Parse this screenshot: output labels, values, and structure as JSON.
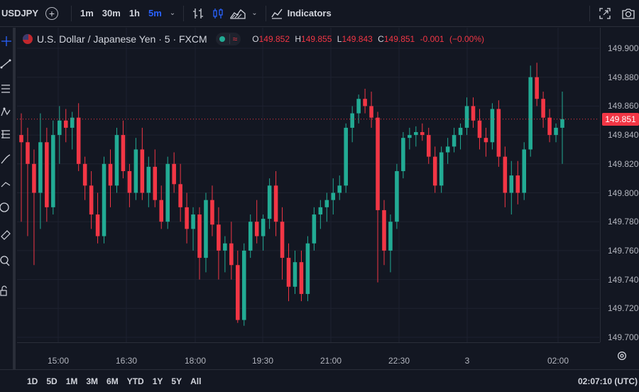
{
  "toolbar": {
    "symbol": "USDJPY",
    "intervals": [
      "1m",
      "30m",
      "1h",
      "5m"
    ],
    "active_interval": "5m",
    "indicators_label": "Indicators",
    "icons": [
      "compare-add-icon",
      "interval-chevron-icon",
      "bar-style-icon",
      "candle-style-icon",
      "area-style-icon",
      "chart-type-chevron-icon",
      "indicators-icon",
      "fullscreen-icon",
      "snapshot-camera-icon"
    ]
  },
  "legend": {
    "title": "U.S. Dollar / Japanese Yen · 5 · FXCM",
    "market_status_icons": [
      "market-open-dot-icon",
      "approx-icon"
    ],
    "approx_symbol": "≈",
    "o_label": "O",
    "o_value": "149.852",
    "h_label": "H",
    "h_value": "149.855",
    "l_label": "L",
    "l_value": "149.843",
    "c_label": "C",
    "c_value": "149.851",
    "change": "-0.001",
    "change_pct": "(−0.00%)"
  },
  "colors": {
    "background": "#131722",
    "up": "#22ab94",
    "down": "#f23645",
    "grid": "#1e2230",
    "text": "#d1d4dc",
    "active": "#2962ff"
  },
  "price_scale": {
    "ticks": [
      "149.900",
      "149.880",
      "149.860",
      "149.840",
      "149.820",
      "149.800",
      "149.780",
      "149.760",
      "149.740",
      "149.720",
      "149.700"
    ],
    "last_price": "149.851"
  },
  "time_scale": {
    "ticks": [
      "15:00",
      "16:30",
      "18:00",
      "19:30",
      "21:00",
      "22:30",
      "3",
      "02:00"
    ],
    "settings_icon": "gear-icon"
  },
  "left_tools_icons": [
    "crosshair-icon",
    "trend-line-icon",
    "fib-icon",
    "brush-icon",
    "text-icon",
    "pattern-icon",
    "circle-icon",
    "ruler-icon",
    "zoom-icon",
    "lock-icon"
  ],
  "bottom_bar": {
    "ranges": [
      "1D",
      "5D",
      "1M",
      "3M",
      "6M",
      "YTD",
      "1Y",
      "5Y",
      "All"
    ],
    "clock": "02:07:10 (UTC)"
  },
  "chart_data": {
    "type": "candlestick",
    "symbol": "USDJPY",
    "ylim": [
      149.69,
      149.915
    ],
    "grid": true,
    "last_price": 149.851,
    "x": [
      "15:00",
      "16:30",
      "18:00",
      "19:30",
      "21:00",
      "22:30",
      "3",
      "02:00"
    ],
    "candles": [
      {
        "o": 149.84,
        "h": 149.855,
        "l": 149.78,
        "c": 149.835
      },
      {
        "o": 149.835,
        "h": 149.845,
        "l": 149.77,
        "c": 149.82
      },
      {
        "o": 149.82,
        "h": 149.83,
        "l": 149.75,
        "c": 149.8
      },
      {
        "o": 149.8,
        "h": 149.855,
        "l": 149.775,
        "c": 149.835
      },
      {
        "o": 149.835,
        "h": 149.845,
        "l": 149.78,
        "c": 149.79
      },
      {
        "o": 149.79,
        "h": 149.85,
        "l": 149.785,
        "c": 149.84
      },
      {
        "o": 149.84,
        "h": 149.86,
        "l": 149.82,
        "c": 149.85
      },
      {
        "o": 149.85,
        "h": 149.858,
        "l": 149.835,
        "c": 149.845
      },
      {
        "o": 149.845,
        "h": 149.856,
        "l": 149.83,
        "c": 149.852
      },
      {
        "o": 149.852,
        "h": 149.862,
        "l": 149.815,
        "c": 149.82
      },
      {
        "o": 149.82,
        "h": 149.825,
        "l": 149.795,
        "c": 149.805
      },
      {
        "o": 149.805,
        "h": 149.815,
        "l": 149.775,
        "c": 149.785
      },
      {
        "o": 149.785,
        "h": 149.8,
        "l": 149.765,
        "c": 149.77
      },
      {
        "o": 149.77,
        "h": 149.825,
        "l": 149.765,
        "c": 149.82
      },
      {
        "o": 149.82,
        "h": 149.83,
        "l": 149.79,
        "c": 149.805
      },
      {
        "o": 149.805,
        "h": 149.845,
        "l": 149.8,
        "c": 149.84
      },
      {
        "o": 149.84,
        "h": 149.85,
        "l": 149.81,
        "c": 149.815
      },
      {
        "o": 149.815,
        "h": 149.82,
        "l": 149.79,
        "c": 149.8
      },
      {
        "o": 149.8,
        "h": 149.838,
        "l": 149.795,
        "c": 149.83
      },
      {
        "o": 149.83,
        "h": 149.845,
        "l": 149.795,
        "c": 149.8
      },
      {
        "o": 149.8,
        "h": 149.825,
        "l": 149.79,
        "c": 149.818
      },
      {
        "o": 149.818,
        "h": 149.83,
        "l": 149.79,
        "c": 149.795
      },
      {
        "o": 149.795,
        "h": 149.805,
        "l": 149.775,
        "c": 149.78
      },
      {
        "o": 149.78,
        "h": 149.825,
        "l": 149.775,
        "c": 149.82
      },
      {
        "o": 149.82,
        "h": 149.828,
        "l": 149.8,
        "c": 149.806
      },
      {
        "o": 149.806,
        "h": 149.82,
        "l": 149.78,
        "c": 149.79
      },
      {
        "o": 149.79,
        "h": 149.8,
        "l": 149.765,
        "c": 149.775
      },
      {
        "o": 149.775,
        "h": 149.79,
        "l": 149.76,
        "c": 149.785
      },
      {
        "o": 149.785,
        "h": 149.79,
        "l": 149.74,
        "c": 149.755
      },
      {
        "o": 149.755,
        "h": 149.8,
        "l": 149.745,
        "c": 149.795
      },
      {
        "o": 149.795,
        "h": 149.805,
        "l": 149.77,
        "c": 149.778
      },
      {
        "o": 149.778,
        "h": 149.79,
        "l": 149.74,
        "c": 149.76
      },
      {
        "o": 149.76,
        "h": 149.77,
        "l": 149.745,
        "c": 149.765
      },
      {
        "o": 149.765,
        "h": 149.78,
        "l": 149.74,
        "c": 149.75
      },
      {
        "o": 149.75,
        "h": 149.76,
        "l": 149.71,
        "c": 149.712
      },
      {
        "o": 149.712,
        "h": 149.765,
        "l": 149.708,
        "c": 149.76
      },
      {
        "o": 149.76,
        "h": 149.785,
        "l": 149.755,
        "c": 149.78
      },
      {
        "o": 149.78,
        "h": 149.795,
        "l": 149.765,
        "c": 149.77
      },
      {
        "o": 149.77,
        "h": 149.785,
        "l": 149.76,
        "c": 149.782
      },
      {
        "o": 149.782,
        "h": 149.81,
        "l": 149.775,
        "c": 149.805
      },
      {
        "o": 149.805,
        "h": 149.815,
        "l": 149.77,
        "c": 149.78
      },
      {
        "o": 149.78,
        "h": 149.79,
        "l": 149.74,
        "c": 149.755
      },
      {
        "o": 149.755,
        "h": 149.765,
        "l": 149.725,
        "c": 149.735
      },
      {
        "o": 149.735,
        "h": 149.76,
        "l": 149.73,
        "c": 149.752
      },
      {
        "o": 149.752,
        "h": 149.76,
        "l": 149.725,
        "c": 149.73
      },
      {
        "o": 149.73,
        "h": 149.77,
        "l": 149.725,
        "c": 149.765
      },
      {
        "o": 149.765,
        "h": 149.79,
        "l": 149.76,
        "c": 149.785
      },
      {
        "o": 149.785,
        "h": 149.795,
        "l": 149.775,
        "c": 149.79
      },
      {
        "o": 149.79,
        "h": 149.8,
        "l": 149.78,
        "c": 149.795
      },
      {
        "o": 149.795,
        "h": 149.81,
        "l": 149.785,
        "c": 149.8
      },
      {
        "o": 149.8,
        "h": 149.812,
        "l": 149.795,
        "c": 149.805
      },
      {
        "o": 149.805,
        "h": 149.848,
        "l": 149.8,
        "c": 149.845
      },
      {
        "o": 149.845,
        "h": 149.86,
        "l": 149.835,
        "c": 149.855
      },
      {
        "o": 149.855,
        "h": 149.868,
        "l": 149.848,
        "c": 149.865
      },
      {
        "o": 149.865,
        "h": 149.872,
        "l": 149.855,
        "c": 149.86
      },
      {
        "o": 149.86,
        "h": 149.87,
        "l": 149.845,
        "c": 149.852
      },
      {
        "o": 149.852,
        "h": 149.856,
        "l": 149.738,
        "c": 149.788
      },
      {
        "o": 149.788,
        "h": 149.795,
        "l": 149.75,
        "c": 149.76
      },
      {
        "o": 149.76,
        "h": 149.785,
        "l": 149.745,
        "c": 149.78
      },
      {
        "o": 149.78,
        "h": 149.82,
        "l": 149.775,
        "c": 149.815
      },
      {
        "o": 149.815,
        "h": 149.842,
        "l": 149.81,
        "c": 149.838
      },
      {
        "o": 149.838,
        "h": 149.845,
        "l": 149.83,
        "c": 149.84
      },
      {
        "o": 149.84,
        "h": 149.846,
        "l": 149.832,
        "c": 149.842
      },
      {
        "o": 149.842,
        "h": 149.848,
        "l": 149.836,
        "c": 149.84
      },
      {
        "o": 149.84,
        "h": 149.845,
        "l": 149.82,
        "c": 149.825
      },
      {
        "o": 149.825,
        "h": 149.832,
        "l": 149.8,
        "c": 149.805
      },
      {
        "o": 149.805,
        "h": 149.832,
        "l": 149.8,
        "c": 149.828
      },
      {
        "o": 149.828,
        "h": 149.838,
        "l": 149.82,
        "c": 149.832
      },
      {
        "o": 149.832,
        "h": 149.845,
        "l": 149.828,
        "c": 149.84
      },
      {
        "o": 149.84,
        "h": 149.848,
        "l": 149.83,
        "c": 149.845
      },
      {
        "o": 149.845,
        "h": 149.866,
        "l": 149.84,
        "c": 149.86
      },
      {
        "o": 149.86,
        "h": 149.866,
        "l": 149.845,
        "c": 149.85
      },
      {
        "o": 149.85,
        "h": 149.858,
        "l": 149.83,
        "c": 149.838
      },
      {
        "o": 149.838,
        "h": 149.845,
        "l": 149.825,
        "c": 149.835
      },
      {
        "o": 149.835,
        "h": 149.862,
        "l": 149.83,
        "c": 149.858
      },
      {
        "o": 149.858,
        "h": 149.864,
        "l": 149.818,
        "c": 149.825
      },
      {
        "o": 149.825,
        "h": 149.832,
        "l": 149.79,
        "c": 149.8
      },
      {
        "o": 149.8,
        "h": 149.822,
        "l": 149.785,
        "c": 149.812
      },
      {
        "o": 149.812,
        "h": 149.822,
        "l": 149.792,
        "c": 149.8
      },
      {
        "o": 149.8,
        "h": 149.835,
        "l": 149.795,
        "c": 149.83
      },
      {
        "o": 149.83,
        "h": 149.888,
        "l": 149.825,
        "c": 149.88
      },
      {
        "o": 149.88,
        "h": 149.89,
        "l": 149.86,
        "c": 149.865
      },
      {
        "o": 149.865,
        "h": 149.87,
        "l": 149.845,
        "c": 149.852
      },
      {
        "o": 149.852,
        "h": 149.858,
        "l": 149.835,
        "c": 149.84
      },
      {
        "o": 149.84,
        "h": 149.848,
        "l": 149.835,
        "c": 149.845
      },
      {
        "o": 149.845,
        "h": 149.87,
        "l": 149.82,
        "c": 149.851
      }
    ]
  }
}
